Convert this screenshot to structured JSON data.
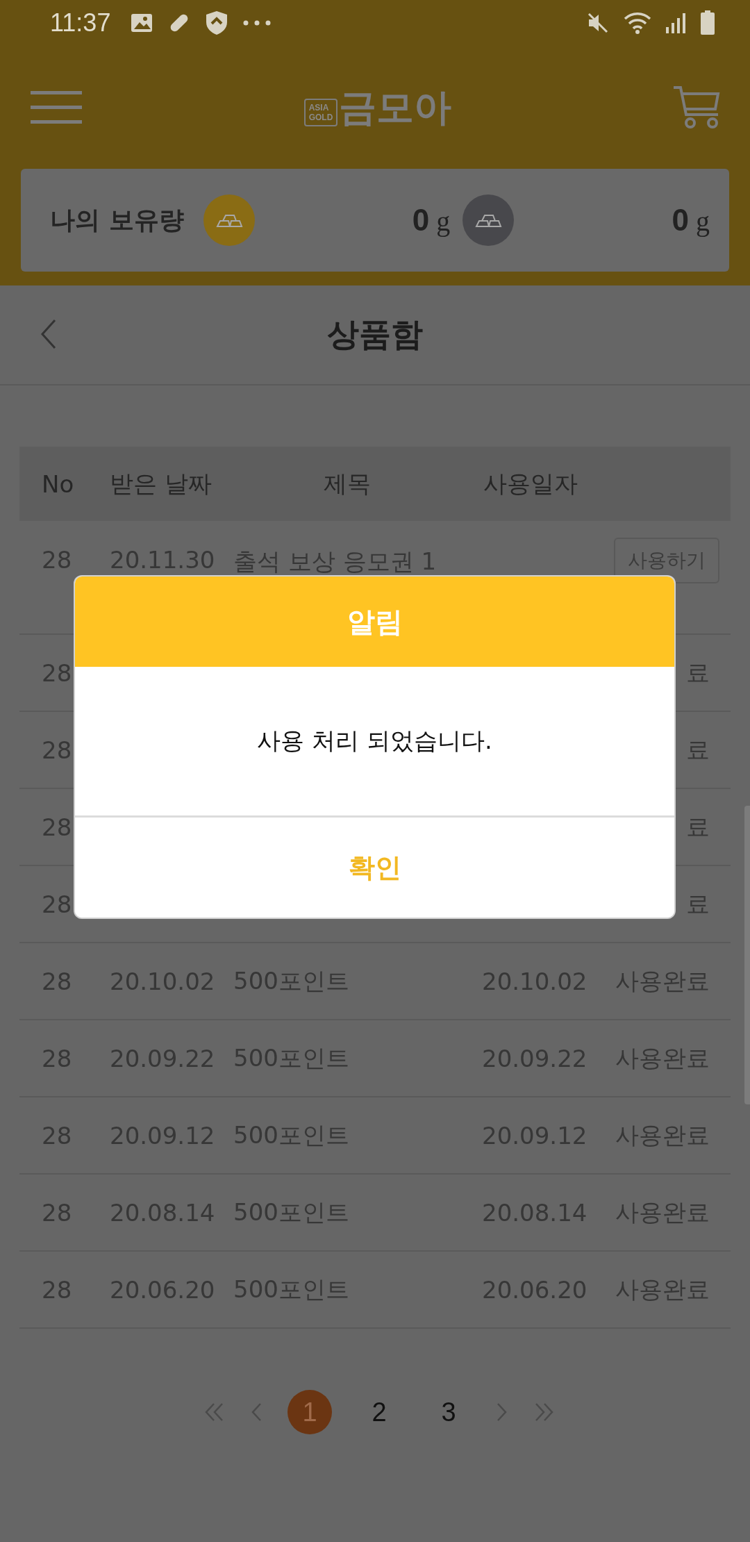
{
  "status_bar": {
    "time": "11:37"
  },
  "app_bar": {
    "logo": {
      "badge_top": "ASIA",
      "badge_bottom": "GOLD",
      "name": "금모아"
    }
  },
  "holdings": {
    "label": "나의 보유량",
    "items": [
      {
        "kind": "gold",
        "amount": "0",
        "unit": "g"
      },
      {
        "kind": "silver",
        "amount": "0",
        "unit": "g"
      }
    ]
  },
  "page": {
    "title": "상품함"
  },
  "table": {
    "columns": [
      "No",
      "받은 날짜",
      "제목",
      "사용일자"
    ],
    "rows": [
      {
        "kind": "pending",
        "no": "28",
        "received": "20.11.30",
        "title": "출석 보상 응모권 1",
        "action": "사용하기"
      },
      {
        "kind": "covered",
        "no": "28",
        "status": "료"
      },
      {
        "kind": "covered",
        "no": "28",
        "status": "료"
      },
      {
        "kind": "covered",
        "no": "28",
        "status": "료"
      },
      {
        "kind": "covered",
        "no": "28",
        "status": "료"
      },
      {
        "kind": "used",
        "no": "28",
        "received": "20.10.02",
        "title": "500포인트",
        "used_date": "20.10.02",
        "status": "사용완료"
      },
      {
        "kind": "used",
        "no": "28",
        "received": "20.09.22",
        "title": "500포인트",
        "used_date": "20.09.22",
        "status": "사용완료"
      },
      {
        "kind": "used",
        "no": "28",
        "received": "20.09.12",
        "title": "500포인트",
        "used_date": "20.09.12",
        "status": "사용완료"
      },
      {
        "kind": "used",
        "no": "28",
        "received": "20.08.14",
        "title": "500포인트",
        "used_date": "20.08.14",
        "status": "사용완료"
      },
      {
        "kind": "used",
        "no": "28",
        "received": "20.06.20",
        "title": "500포인트",
        "used_date": "20.06.20",
        "status": "사용완료"
      }
    ]
  },
  "pagination": {
    "pages": [
      {
        "label": "1",
        "selected": true
      },
      {
        "label": "2",
        "selected": false
      },
      {
        "label": "3",
        "selected": false
      }
    ]
  },
  "dialog": {
    "title": "알림",
    "message": "사용 처리 되었습니다.",
    "button": "확인"
  }
}
